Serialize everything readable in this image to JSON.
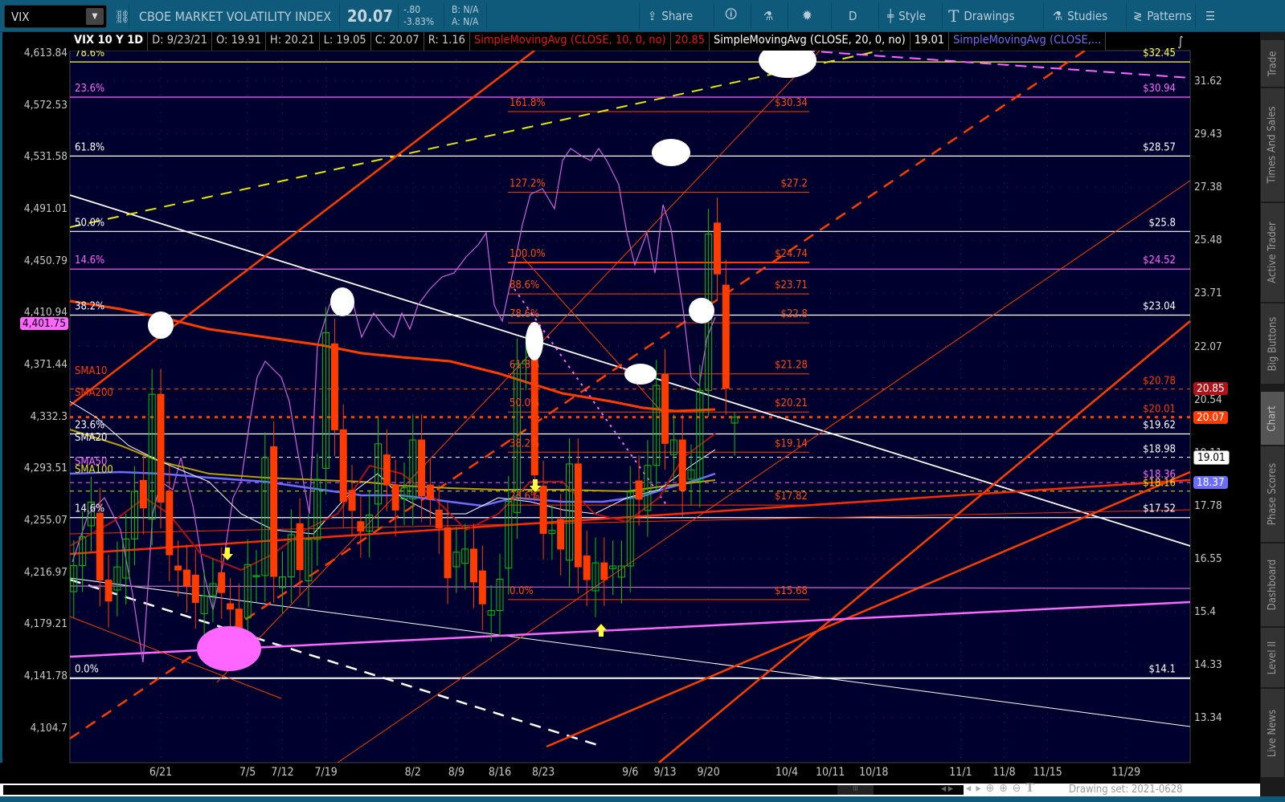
{
  "toolbar": {
    "symbol": "VIX",
    "description": "CBOE MARKET VOLATILITY INDEX",
    "last": "20.07",
    "change": "-.80",
    "change_pct": "-3.83%",
    "bid": "B: N/A",
    "ask": "A: N/A",
    "share": "Share",
    "timeframe": "D",
    "style": "Style",
    "drawings": "Drawings",
    "studies": "Studies",
    "patterns": "Patterns"
  },
  "infobar": {
    "title": "VIX 10 Y 1D",
    "date": "D: 9/23/21",
    "open": "O: 19.91",
    "high": "H: 20.21",
    "low": "L: 19.05",
    "close": "C: 20.07",
    "range": "R: 1.16",
    "sma10_label": "SimpleMovingAvg (CLOSE, 10, 0, no)",
    "sma10_value": "20.85",
    "sma20_label": "SimpleMovingAvg (CLOSE, 20, 0, no)",
    "sma20_value": "19.01",
    "sma50_label": "SimpleMovingAvg (CLOSE,..."
  },
  "sidebar": {
    "tabs": [
      "Trade",
      "Times And Sales",
      "Active Trader",
      "Big Buttons",
      "Chart",
      "Phase Scores",
      "Dashboard",
      "Level II",
      "Live News"
    ],
    "active": "Chart"
  },
  "bottom": {
    "drawing_set": "Drawing set: 2021-0628"
  },
  "colors": {
    "up": "#00c800",
    "down": "#ff3c00",
    "bg": "#00002e",
    "sma10": "#b0121b",
    "last": "#ff3c00",
    "sma20": "#ffffff",
    "sma50": "#6c6cff"
  },
  "chart_data": {
    "type": "candlestick",
    "symbol": "VIX",
    "period": "10 Y",
    "interval": "1D",
    "scale": "log",
    "right_axis_ticks": [
      "31.62",
      "29.43",
      "27.38",
      "25.48",
      "23.71",
      "22.07",
      "20.54",
      "19.11",
      "17.78",
      "16.55",
      "15.4",
      "14.33",
      "13.34"
    ],
    "left_axis_ticks": [
      "4,613.84",
      "4,572.53",
      "4,531.58",
      "4,491.01",
      "4,450.79",
      "4,410.94",
      "4,371.44",
      "4,332.3",
      "4,293.51",
      "4,255.07",
      "4,216.97",
      "4,179.21",
      "4,141.78",
      "4,104.7"
    ],
    "left_axis_marker": "4,401.75",
    "x_labels": [
      {
        "t": "6/21",
        "i": 10
      },
      {
        "t": "7/5",
        "i": 20
      },
      {
        "t": "7/12",
        "i": 24
      },
      {
        "t": "7/19",
        "i": 29
      },
      {
        "t": "8/2",
        "i": 39
      },
      {
        "t": "8/9",
        "i": 44
      },
      {
        "t": "8/16",
        "i": 49
      },
      {
        "t": "8/23",
        "i": 54
      },
      {
        "t": "9/6",
        "i": 64
      },
      {
        "t": "9/13",
        "i": 68
      },
      {
        "t": "9/20",
        "i": 73
      },
      {
        "t": "10/4",
        "i": 82
      },
      {
        "t": "10/11",
        "i": 87
      },
      {
        "t": "10/18",
        "i": 92
      },
      {
        "t": "11/1",
        "i": 102
      },
      {
        "t": "11/8",
        "i": 107
      },
      {
        "t": "11/15",
        "i": 112
      },
      {
        "t": "11/29",
        "i": 121
      }
    ],
    "closes": [
      16.42,
      17.07,
      17.89,
      16.1,
      15.65,
      16.39,
      17.02,
      18.15,
      17.75,
      20.7,
      17.89,
      16.66,
      16.32,
      15.97,
      15.62,
      15.76,
      16.02,
      15.83,
      15.48,
      15.07,
      16.44,
      16.2,
      19.0,
      16.18,
      16.17,
      17.12,
      16.33,
      17.01,
      18.45,
      22.5,
      19.73,
      17.91,
      17.69,
      17.2,
      17.58,
      19.36,
      18.31,
      17.7,
      18.24,
      19.46,
      18.04,
      17.97,
      17.28,
      16.15,
      16.72,
      16.79,
      16.06,
      15.59,
      15.45,
      16.12,
      17.91,
      21.57,
      21.67,
      18.56,
      17.15,
      17.22,
      16.79,
      18.84,
      16.39,
      16.11,
      16.48,
      16.11,
      16.41,
      16.41,
      18.14,
      17.96,
      18.8,
      20.95,
      19.37,
      19.46,
      18.18,
      18.69,
      20.81,
      25.71,
      24.36,
      20.87,
      20.07
    ],
    "last_bar": {
      "open": 19.91,
      "high": 20.21,
      "low": 19.05,
      "close": 20.07
    },
    "fib_orange": [
      {
        "pct": "161.8%",
        "price": "$30.34",
        "v": 30.34
      },
      {
        "pct": "127.2%",
        "price": "$27.2",
        "v": 27.2
      },
      {
        "pct": "100.0%",
        "price": "$24.74",
        "v": 24.74
      },
      {
        "pct": "88.6%",
        "price": "$23.71",
        "v": 23.71
      },
      {
        "pct": "78.6%",
        "price": "$22.8",
        "v": 22.8
      },
      {
        "pct": "61.8%",
        "price": "$21.28",
        "v": 21.28
      },
      {
        "pct": "50.0%",
        "price": "$20.21",
        "v": 20.21
      },
      {
        "pct": "38.2%",
        "price": "$19.14",
        "v": 19.14
      },
      {
        "pct": "23.6%",
        "price": "$17.82",
        "v": 17.82
      },
      {
        "pct": "0.0%",
        "price": "$15.68",
        "v": 15.68
      }
    ],
    "fib_white": [
      {
        "pct": "61.8%",
        "price": "$28.57",
        "v": 28.57
      },
      {
        "pct": "50.0%",
        "price": "$25.8",
        "v": 25.8
      },
      {
        "pct": "38.2%",
        "price": "$23.04",
        "v": 23.04
      },
      {
        "pct": "23.6%",
        "price": "$19.62",
        "v": 19.62
      },
      {
        "pct": "14.6%",
        "price": "$17.52",
        "v": 17.52
      },
      {
        "pct": "0.0%",
        "price": "$14.1",
        "v": 14.1
      }
    ],
    "fib_pink": [
      {
        "pct": "78.6%",
        "price": "$32.45",
        "v": 32.45
      },
      {
        "pct": "23.6%",
        "price": "$30.94",
        "v": 30.94
      },
      {
        "pct": "14.6%",
        "price": "$24.52",
        "v": 24.52
      }
    ],
    "studies": [
      {
        "name": "SMA10",
        "price": "$20.78",
        "v": 20.85,
        "badge": "20.85",
        "color": "#ff3c00"
      },
      {
        "name": "SMA200",
        "price": "$20.01",
        "v": 20.07,
        "badge": "20.07",
        "color": "#ff3c00"
      },
      {
        "name": "SMA20",
        "price": "$18.98",
        "v": 19.01,
        "badge": "19.01",
        "color": "#ffffff"
      },
      {
        "name": "SMA50",
        "price": "$18.36",
        "v": 18.37,
        "badge": "18.37",
        "color": "#ff66ff"
      },
      {
        "name": "SMA100",
        "price": "$18.16",
        "v": 18.16,
        "badge": "",
        "color": "#e6e600"
      }
    ]
  }
}
